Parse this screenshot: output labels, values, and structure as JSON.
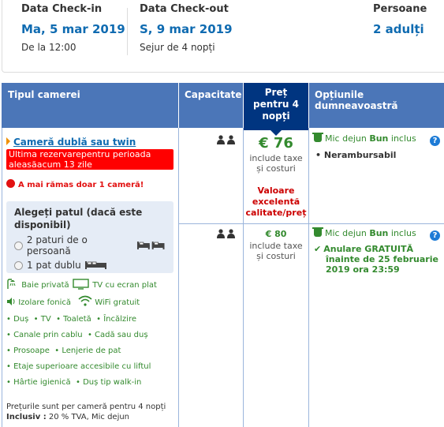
{
  "summary": {
    "checkin_label": "Data Check-in",
    "checkin_value": "Ma, 5 mar 2019",
    "checkin_sub": "De la 12:00",
    "checkout_label": "Data Check-out",
    "checkout_value": "S, 9 mar 2019",
    "checkout_sub": "Sejur de 4 nopți",
    "guests_label": "Persoane",
    "guests_value": "2 adulți"
  },
  "table": {
    "col_room": "Tipul camerei",
    "col_capacity": "Capacitate",
    "col_price": [
      "Preț",
      "pentru 4",
      "nopți"
    ],
    "col_options": "Opțiunile dumneavoastră"
  },
  "room": {
    "name": "Cameră dublă sau twin",
    "alert_line1": "Ultima rezervarepentru perioada",
    "alert_line2": "aleasăacum 13 zile",
    "rooms_left": "A mai rămas doar 1 cameră!",
    "bed_title": "Alegeți patul (dacă este disponibil)",
    "bed_option_1": "2 paturi de o persoană",
    "bed_option_2": "1 pat dublu",
    "facilities_icons": [
      {
        "icon": "shower-icon",
        "label": "Baie privată"
      },
      {
        "icon": "tv-icon",
        "label": "TV cu ecran plat"
      },
      {
        "icon": "soundproof-icon",
        "label": "Izolare fonică"
      },
      {
        "icon": "wifi-icon",
        "label": "WiFi gratuit"
      }
    ],
    "facilities": [
      "Duș",
      "TV",
      "Toaletă",
      "Încălzire",
      "Canale prin cablu",
      "Cadă sau duș",
      "Prosoape",
      "Lenjerie de pat",
      "Etaje superioare accesibile cu liftul",
      "Hârtie igienică",
      "Duș tip walk-in"
    ],
    "note_line1": "Prețurile sunt per cameră pentru 4 nopți",
    "note_bold": "Inclusiv :",
    "note_rest": "20 % TVA, Mic dejun"
  },
  "options": [
    {
      "price": "€ 76",
      "price_note_1": "include taxe",
      "price_note_2": "și costuri",
      "value_tag": [
        "Valoare",
        "excelentă",
        "calitate/preț"
      ],
      "breakfast_pre": "Mic dejun",
      "breakfast_bold": "Bun",
      "breakfast_post": "inclus",
      "policy": "Nerambursabil"
    },
    {
      "price": "€ 80",
      "price_note_1": "include taxe",
      "price_note_2": "și costuri",
      "breakfast_pre": "Mic dejun",
      "breakfast_bold": "Bun",
      "breakfast_post": "inclus",
      "cancel_1": "Anulare GRATUITĂ",
      "cancel_2": "înainte de 25 februarie",
      "cancel_3": "2019 ora 23:59"
    }
  ],
  "help_symbol": "?",
  "colors": {
    "header_bg": "#4b76b8",
    "price_header_bg": "#003580",
    "link_blue": "#0f6bb1",
    "green": "#338a2e",
    "red": "#ff0000",
    "bed_box_bg": "#e5ecf6"
  }
}
